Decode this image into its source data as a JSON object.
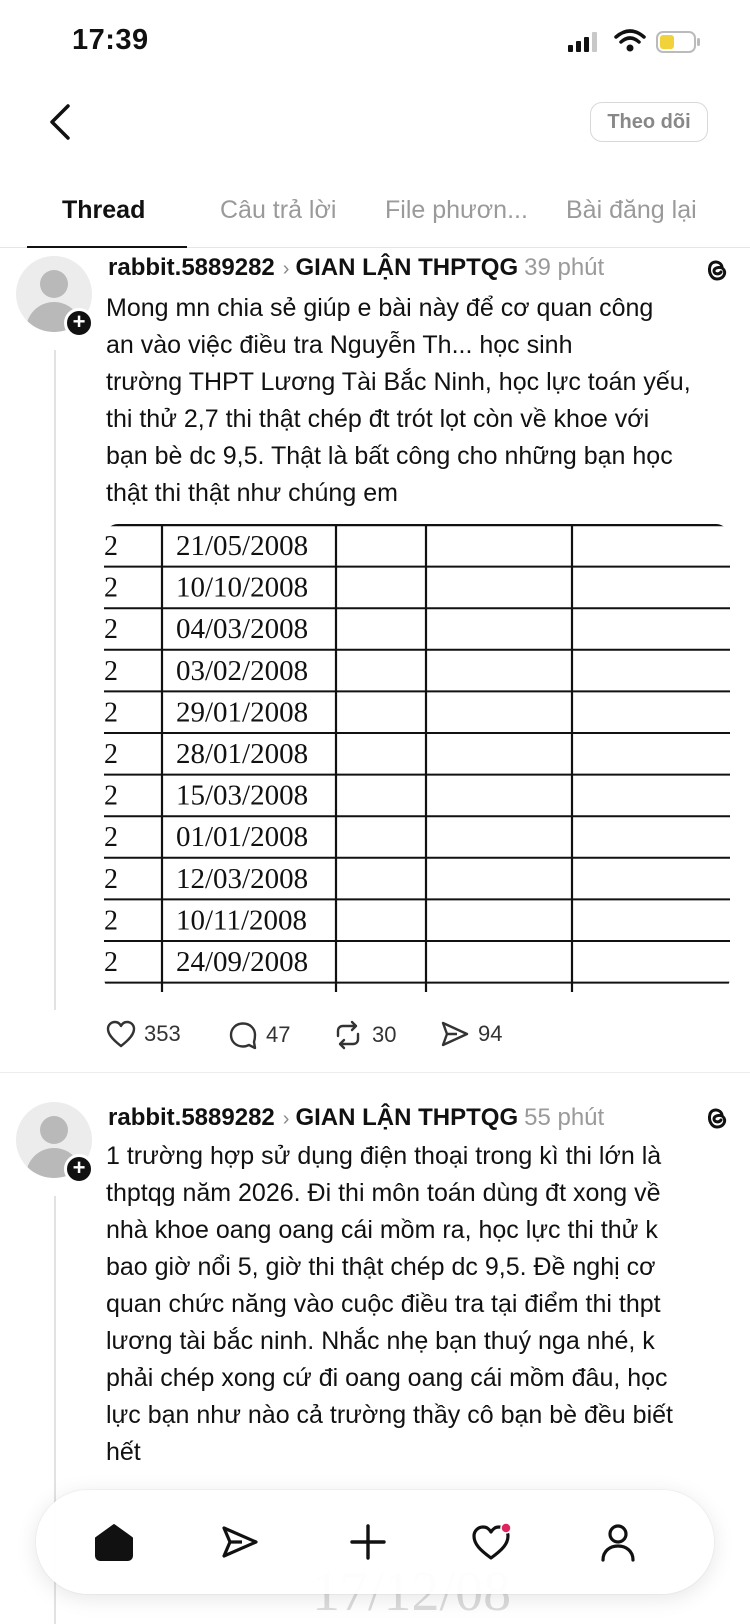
{
  "status_bar": {
    "time": "17:39"
  },
  "header": {
    "follow_label": "Theo dõi"
  },
  "tabs": [
    {
      "label": "Thread",
      "active": true
    },
    {
      "label": "Câu trả lời",
      "active": false
    },
    {
      "label": "File phươn...",
      "active": false
    },
    {
      "label": "Bài đăng lại",
      "active": false
    }
  ],
  "posts": [
    {
      "username": "rabbit.5889282",
      "group": "GIAN LẬN THPTQG",
      "time": "39 phút",
      "text_lines": [
        "Mong mn chia sẻ giúp e bài này để cơ quan công",
        "an vào việc điều tra Nguyễn Th...  học sinh",
        "trường THPT Lương Tài Bắc Ninh, học lực toán yếu,",
        "thi thử 2,7 thi thật chép đt trót lọt còn về khoe với",
        "bạn bè dc 9,5. Thật là bất công cho những bạn học",
        "thật thi thật như chúng em"
      ],
      "table_rows": [
        {
          "col1": "2",
          "date": "21/05/2008"
        },
        {
          "col1": "2",
          "date": "10/10/2008"
        },
        {
          "col1": "2",
          "date": "04/03/2008"
        },
        {
          "col1": "2",
          "date": "03/02/2008"
        },
        {
          "col1": "2",
          "date": "29/01/2008"
        },
        {
          "col1": "2",
          "date": "28/01/2008"
        },
        {
          "col1": "2",
          "date": "15/03/2008"
        },
        {
          "col1": "2",
          "date": "01/01/2008"
        },
        {
          "col1": "2",
          "date": "12/03/2008"
        },
        {
          "col1": "2",
          "date": "10/11/2008"
        },
        {
          "col1": "2",
          "date": "24/09/2008"
        }
      ],
      "likes": "353",
      "comments": "47",
      "reposts": "30",
      "shares": "94"
    },
    {
      "username": "rabbit.5889282",
      "group": "GIAN LẬN THPTQG",
      "time": "55 phút",
      "text_lines": [
        "1 trường hợp sử dụng điện thoại trong kì thi lớn là",
        "thptqg năm 2026. Đi thi môn toán dùng đt xong về",
        "nhà khoe oang oang cái mồm ra, học lực thi thử k",
        "bao giờ nổi 5, giờ thi thật chép dc 9,5. Đề nghị cơ",
        "quan chức năng vào cuộc điều tra tại điểm thi thpt",
        "lương tài bắc ninh. Nhắc nhẹ bạn thuý nga nhé, k",
        "phải chép xong cứ đi oang oang cái mồm đâu, học",
        "lực bạn như nào cả trường thầy cô bạn bè đều biết",
        "hết"
      ],
      "ghost_text": "17/12/08"
    }
  ],
  "bottom_nav": [
    {
      "name": "home",
      "icon": "home-icon"
    },
    {
      "name": "send",
      "icon": "send-icon"
    },
    {
      "name": "new-post",
      "icon": "plus-icon"
    },
    {
      "name": "activity",
      "icon": "heart-icon"
    },
    {
      "name": "profile",
      "icon": "person-icon"
    }
  ],
  "colors": {
    "accent_dot": "#e0245e",
    "muted_text": "#9a9a9a"
  }
}
